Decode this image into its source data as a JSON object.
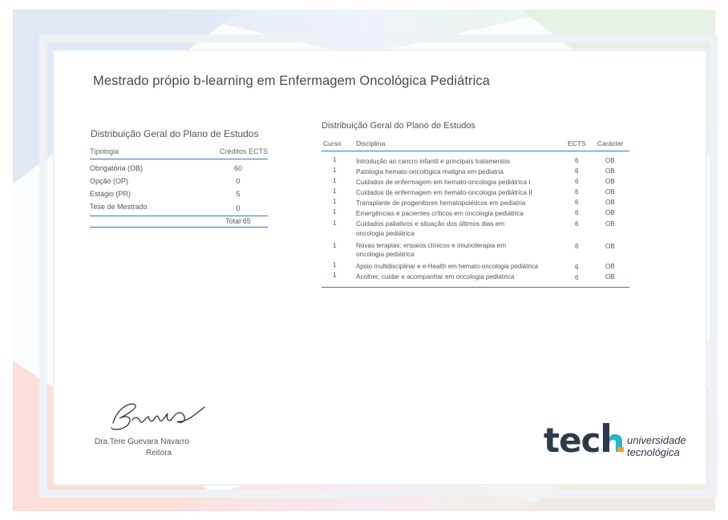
{
  "title": "Mestrado própio b-learning em Enfermagem Oncológica Pediátrica",
  "summary": {
    "title": "Distribuição Geral do Plano de Estudos",
    "col_type": "Tipologia",
    "col_credits": "Créditos ECTS",
    "rows": [
      {
        "label": "Obrigatória (OB)",
        "value": "60"
      },
      {
        "label": "Opção (OP)",
        "value": "0"
      },
      {
        "label": "Estágio (PR)",
        "value": "5"
      },
      {
        "label": "Tese de Mestrado",
        "value": "0"
      }
    ],
    "total": "Total 65"
  },
  "detail": {
    "title": "Distribuição Geral do Plano de Estudos",
    "col_curso": "Curso",
    "col_disciplina": "Disciplina",
    "col_ects": "ECTS",
    "col_caracter": "Carácter",
    "rows": [
      {
        "curso": "1",
        "disciplina": "Introdução ao cancro infantil e principais tratamentos",
        "ects": "6",
        "caracter": "OB"
      },
      {
        "curso": "1",
        "disciplina": "Patologia hemato-oncológica maligna em pediatria",
        "ects": "6",
        "caracter": "OB"
      },
      {
        "curso": "1",
        "disciplina": "Cuidados de enfermagem em hemato-oncologia pediátrica I",
        "ects": "6",
        "caracter": "OB"
      },
      {
        "curso": "1",
        "disciplina": "Cuidados de enfermagem em hemato-oncologia pediátrica II",
        "ects": "6",
        "caracter": "OB"
      },
      {
        "curso": "1",
        "disciplina": "Transplante de progenitores hematopoiéticos em pediatria",
        "ects": "6",
        "caracter": "OB"
      },
      {
        "curso": "1",
        "disciplina": "Emergências e pacientes críticos em oncologia pediátrica",
        "ects": "6",
        "caracter": "OB"
      },
      {
        "curso": "1",
        "disciplina": "Cuidados paliativos e situação dos últimos dias em oncologia pediátrica",
        "ects": "6",
        "caracter": "OB"
      },
      {
        "curso": "1",
        "disciplina": "Novas terapias: ensaios clínicos e imunoterapia em oncologia pediátrica",
        "ects": "6",
        "caracter": "OB"
      },
      {
        "curso": "1",
        "disciplina": "Apoio multidisciplinar e e-Health em hemato-oncologia pediátrica",
        "ects": "6",
        "caracter": "OB"
      },
      {
        "curso": "1",
        "disciplina": "Acolher, cuidar e acompanhar em oncologia pediátrica",
        "ects": "6",
        "caracter": "OB"
      }
    ]
  },
  "signature": {
    "name": "Dra.Tere Guevara Navarro",
    "role": "Reitora"
  },
  "logo": {
    "brand": "tech",
    "line1": "universidade",
    "line2": "tecnológica",
    "accent_color": "#29b6c8",
    "accent_color2": "#f3a21d"
  },
  "colors": {
    "table_rule": "#3a76b8",
    "text": "#555555"
  }
}
